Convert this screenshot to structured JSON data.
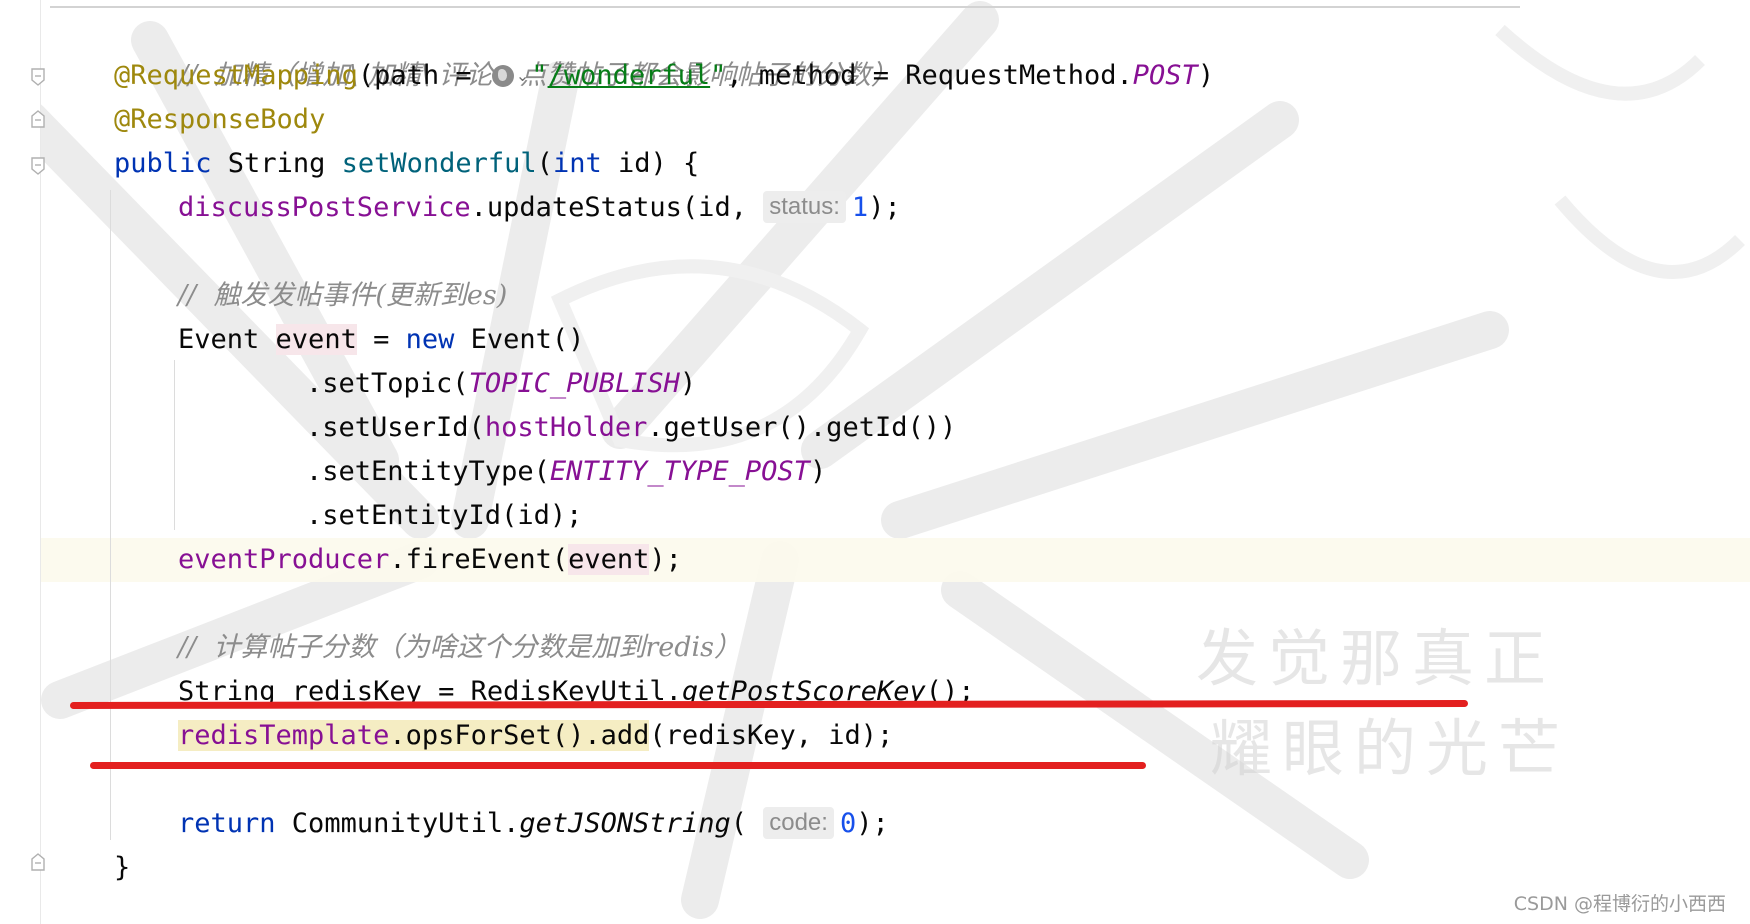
{
  "colors": {
    "keyword": "#0033b3",
    "annotation": "#9e880d",
    "string": "#067d17",
    "field": "#871094",
    "number": "#1750eb",
    "method_decl": "#00627a",
    "comment": "#8c8c8c",
    "underline_marker": "#e3201f"
  },
  "code": {
    "l1": {
      "comment": "//  加精（增加\\ 加精\\ 评论、点赞帖子都会影响帖子的分数）"
    },
    "l2": {
      "annotation": "@RequestMapping",
      "open": "(path = ",
      "q1": "\"",
      "path": "/wonderful",
      "q2": "\"",
      "mid": ", method = RequestMethod.",
      "post": "POST",
      "close": ")"
    },
    "l3": {
      "annotation": "@ResponseBody"
    },
    "l4": {
      "kw_public": "public",
      "type": " String ",
      "method": "setWonderful",
      "paren": "(",
      "kw_int": "int",
      "rest": " id) {"
    },
    "l5": {
      "field": "discussPostService",
      "call": ".updateStatus(id, ",
      "hint": "status:",
      "num": "1",
      "end": ");"
    },
    "l7": {
      "comment": "//  触发发帖事件(更新到es)"
    },
    "l8": {
      "type": "Event ",
      "var": "event",
      "eq": " = ",
      "kw_new": "new",
      "rest": " Event()"
    },
    "l9": {
      "call": ".setTopic(",
      "const": "TOPIC_PUBLISH",
      "end": ")"
    },
    "l10": {
      "call": ".setUserId(",
      "field": "hostHolder",
      "rest": ".getUser().getId())"
    },
    "l11": {
      "call": ".setEntityType(",
      "const": "ENTITY_TYPE_POST",
      "end": ")"
    },
    "l12": {
      "call": ".setEntityId(id);"
    },
    "l13": {
      "field": "eventProducer",
      "call": ".fireEvent(",
      "var": "event",
      "end": ");"
    },
    "l15": {
      "comment": "//  计算帖子分数（为啥这个分数是加到redis）"
    },
    "l16": {
      "decl": "String redisKey = RedisKeyUtil.",
      "static_call": "getPostScoreKey",
      "end": "();"
    },
    "l17": {
      "field": "redisTemplate",
      "call": ".opsForSet().add",
      "rest": "(redisKey, id);"
    },
    "l19": {
      "kw_return": "return",
      "cls": " CommunityUtil.",
      "static_call": "getJSONString",
      "paren": "( ",
      "hint": "code:",
      "num": "0",
      "end": ");"
    },
    "l20": {
      "brace": "}"
    }
  },
  "watermark": {
    "line1": "发觉那真正",
    "line2": "耀眼的光芒"
  },
  "footer": {
    "credit": "CSDN @程博衍的小西西"
  }
}
